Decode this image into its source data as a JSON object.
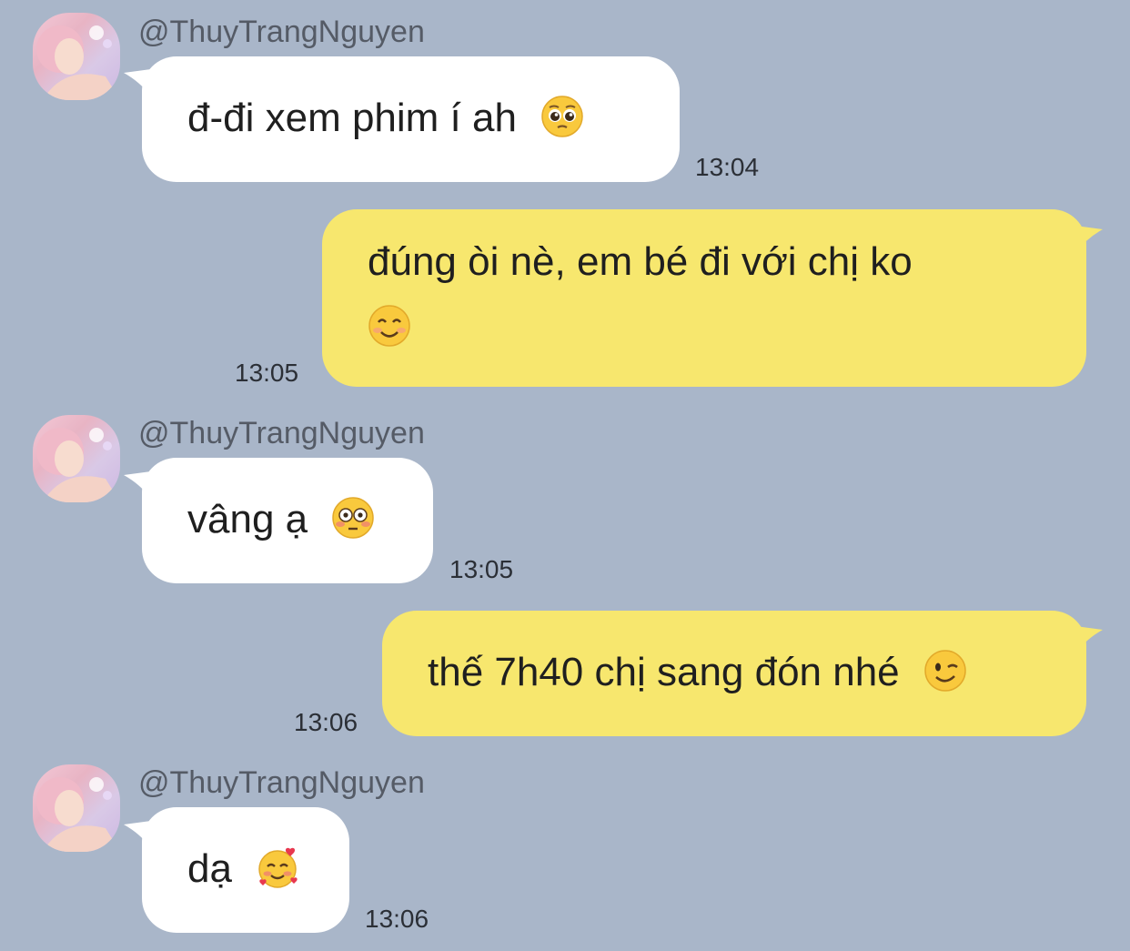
{
  "chat": {
    "messages": [
      {
        "side": "incoming",
        "sender": "@ThuyTrangNguyen",
        "text": "đ-đi xem phim í ah",
        "emoji": "pleading-face-icon",
        "time": "13:04"
      },
      {
        "side": "outgoing",
        "text_line1": "đúng òi nè, em bé đi với chị ko",
        "emoji": "smiling-face-icon",
        "time": "13:05"
      },
      {
        "side": "incoming",
        "sender": "@ThuyTrangNguyen",
        "text": "vâng ạ",
        "emoji": "flushed-face-icon",
        "time": "13:05"
      },
      {
        "side": "outgoing",
        "text": "thế 7h40 chị sang đón nhé",
        "emoji": "winking-face-icon",
        "time": "13:06"
      },
      {
        "side": "incoming",
        "sender": "@ThuyTrangNguyen",
        "text": "dạ",
        "emoji": "smiling-face-with-hearts-icon",
        "time": "13:06"
      }
    ]
  },
  "colors": {
    "background": "#a9b6c9",
    "incoming_bubble": "#ffffff",
    "outgoing_bubble": "#f7e76e",
    "timestamp": "#2b2f36",
    "sender_name": "#555b66"
  }
}
